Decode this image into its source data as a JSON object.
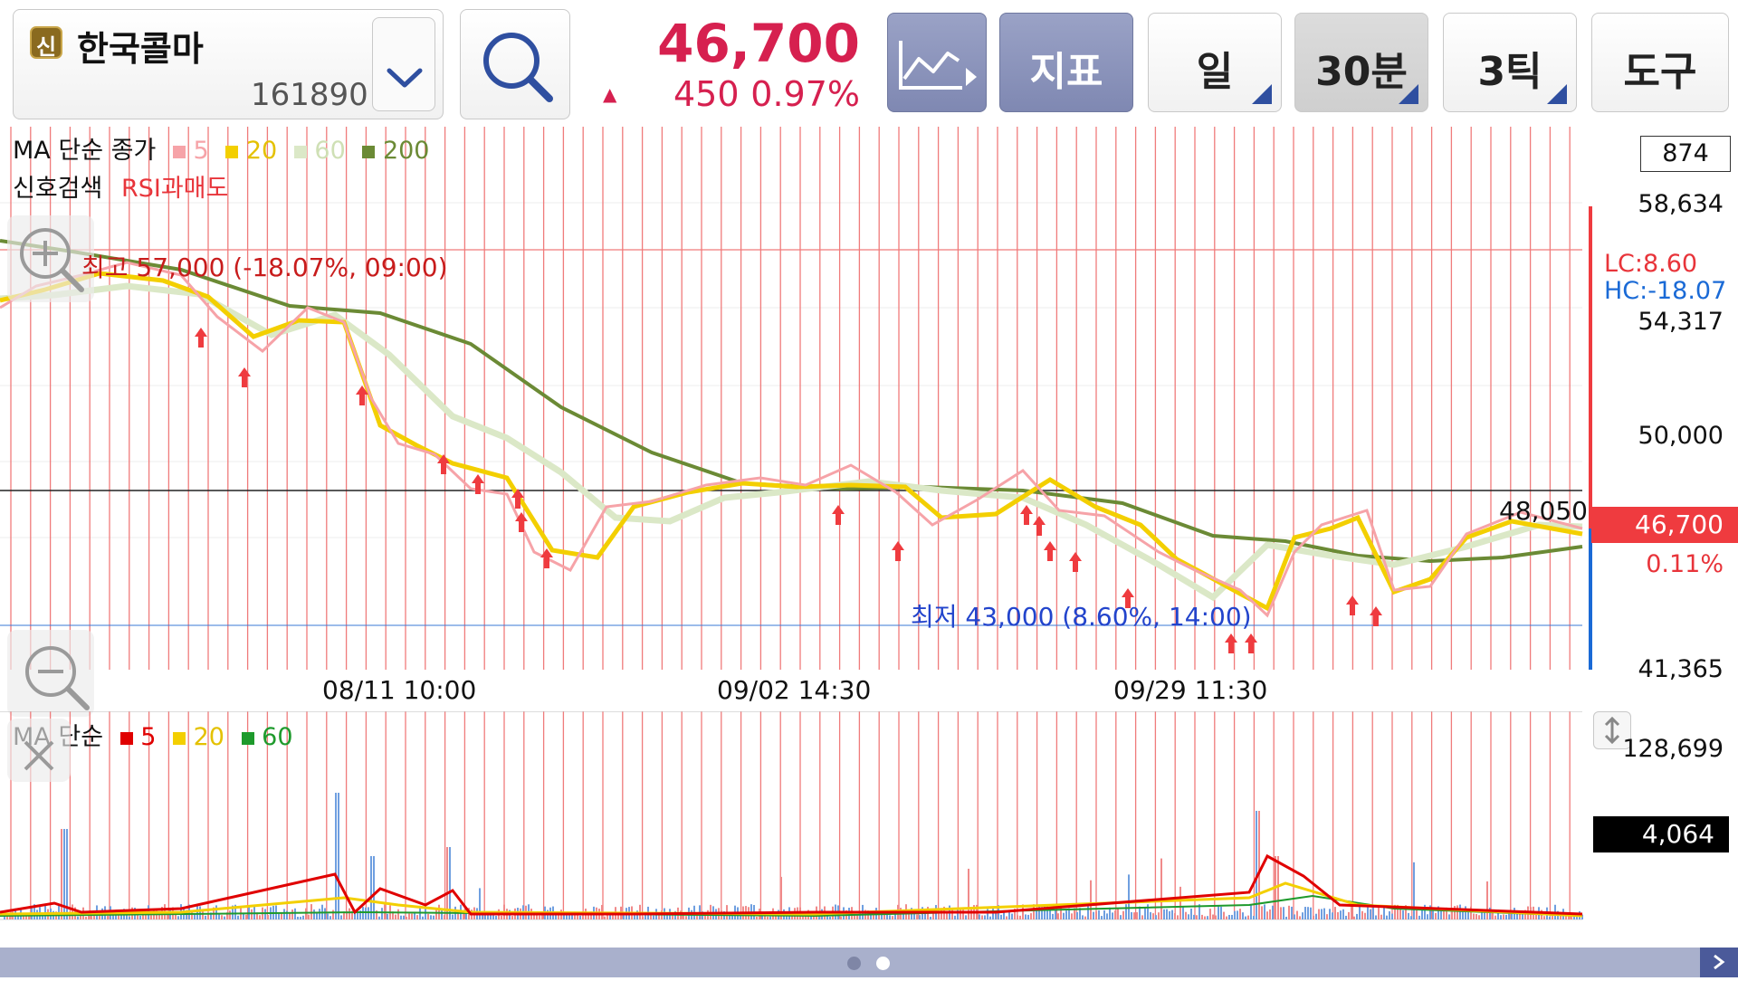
{
  "stock": {
    "badge": "신",
    "name": "한국콜마",
    "code": "161890",
    "price": "46,700",
    "change_arrow": "▲",
    "change": "450",
    "change_pct": "0.97%"
  },
  "toolbar": {
    "indicator_label": "지표",
    "period_label": "일",
    "interval_label": "30분",
    "tick_label": "3틱",
    "tools_label": "도구"
  },
  "main_chart": {
    "legend_prefix": "MA 단순 종가",
    "ma": [
      {
        "label": "5",
        "color": "#f6a3a8"
      },
      {
        "label": "20",
        "color": "#f3cf00"
      },
      {
        "label": "60",
        "color": "#dbe8c7"
      },
      {
        "label": "200",
        "color": "#6b8a35"
      }
    ],
    "signal_label": "신호검색",
    "signal_value": "RSI과매도",
    "count_box": "874",
    "high_annotation": "최고 57,000 (-18.07%, 09:00)",
    "low_annotation": "최저 43,000 (8.60%, 14:00)",
    "ref_price": "48,050",
    "lc": "LC:8.60",
    "hc": "HC:-18.07",
    "current_price_tag": "46,700",
    "current_pct": "0.11%",
    "y_ticks": [
      "58,634",
      "54,317",
      "50,000",
      "41,365"
    ],
    "x_labels": [
      "08/11 10:00",
      "09/02 14:30",
      "09/29 11:30"
    ]
  },
  "volume_chart": {
    "legend_prefix": "MA 단순",
    "ma": [
      {
        "label": "5",
        "color": "#e00000"
      },
      {
        "label": "20",
        "color": "#f3cf00"
      },
      {
        "label": "60",
        "color": "#1e9a2c"
      }
    ],
    "y_tick": "128,699",
    "current_value": "4,064"
  },
  "colors": {
    "accent_red": "#d6204f",
    "toolbar_blue": "#8d96bd",
    "ma5": "#f6a3a8",
    "ma20": "#f3cf00",
    "ma60": "#dbe8c7",
    "ma200": "#6b8a35"
  },
  "icons": {
    "search": "search-icon",
    "dropdown": "chevron-down-icon",
    "chart_type": "line-chart-icon",
    "zoom_in": "zoom-in-icon",
    "zoom_out": "zoom-out-icon",
    "close": "close-icon",
    "resize": "resize-vertical-icon",
    "scroll_right": "chevron-right-icon"
  }
}
